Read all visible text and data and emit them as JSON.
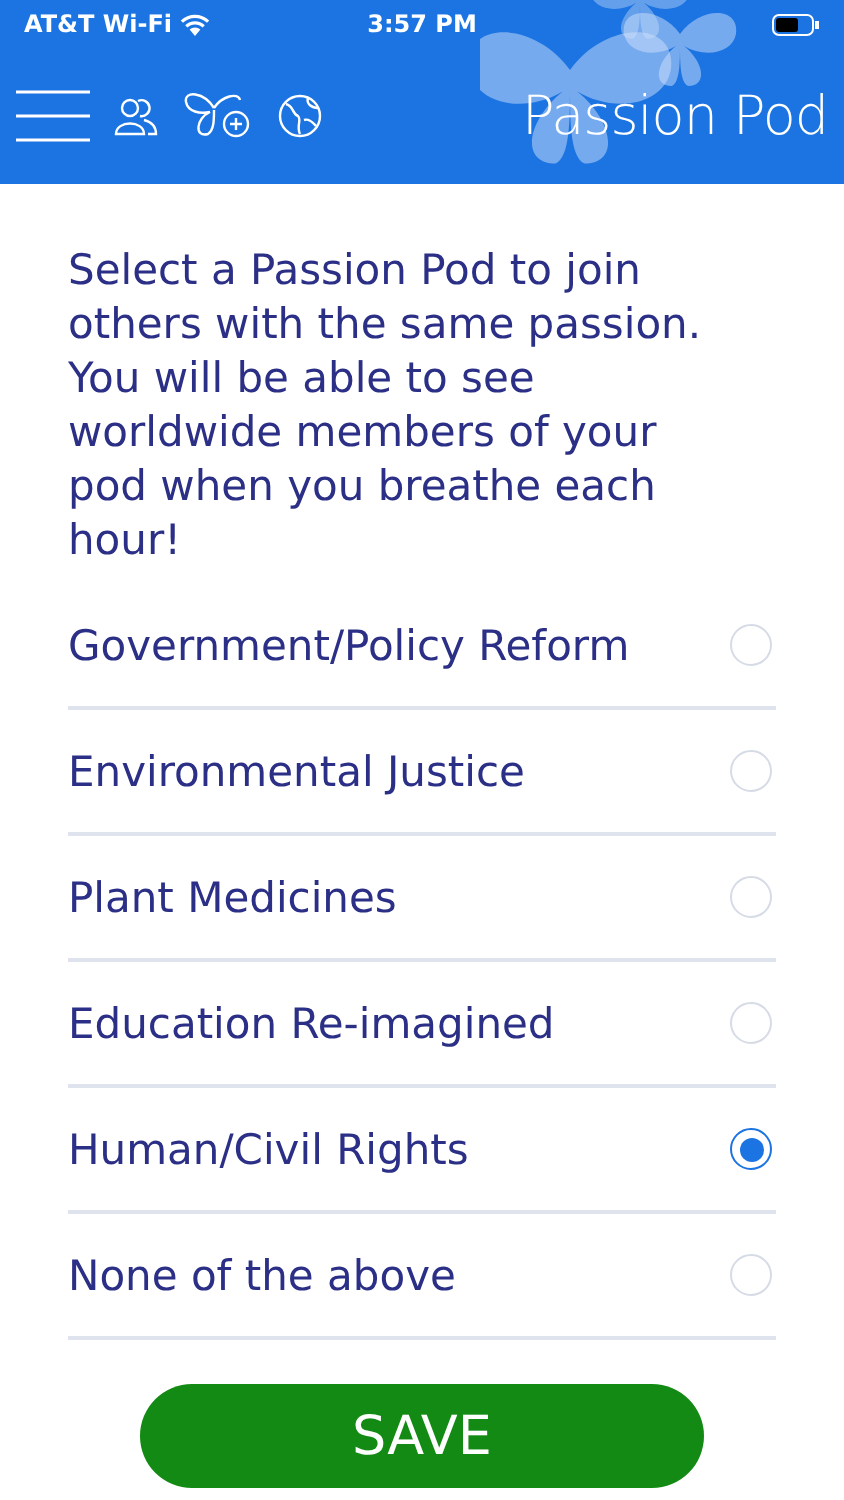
{
  "status_bar": {
    "carrier": "AT&T Wi-Fi",
    "time": "3:57 PM"
  },
  "header": {
    "title": "Passion Pod"
  },
  "intro": "Select a Passion Pod to join others with the same passion. You will be able to see worldwide members of your pod when you breathe each hour!",
  "options": [
    {
      "label": "Government/Policy Reform",
      "selected": false
    },
    {
      "label": "Environmental Justice",
      "selected": false
    },
    {
      "label": "Plant Medicines",
      "selected": false
    },
    {
      "label": "Education Re-imagined",
      "selected": false
    },
    {
      "label": "Human/Civil Rights",
      "selected": true
    },
    {
      "label": "None of the above",
      "selected": false
    }
  ],
  "save_button": "SAVE"
}
